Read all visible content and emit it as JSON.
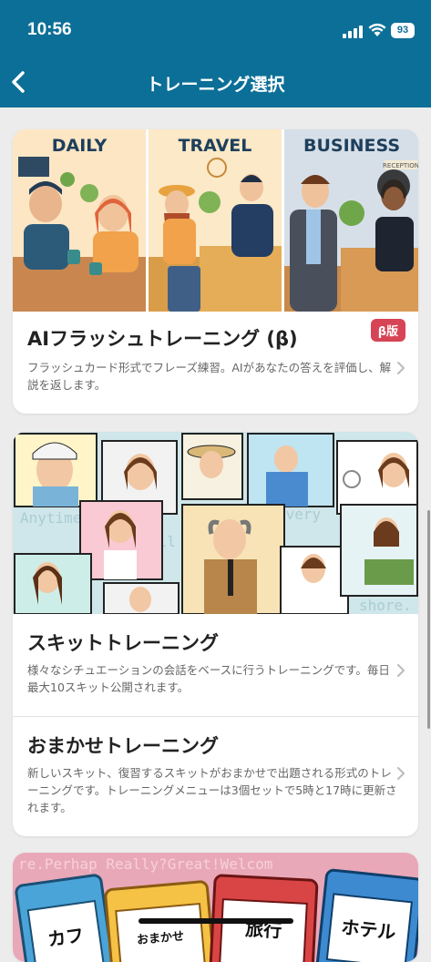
{
  "status": {
    "time": "10:56",
    "battery": "93"
  },
  "nav": {
    "title": "トレーニング選択"
  },
  "cards": {
    "flash": {
      "labels": [
        "DAILY",
        "TRAVEL",
        "BUSINESS"
      ],
      "sign": "RECEPTION",
      "title": "AIフラッシュトレーニング (β)",
      "badge": "β版",
      "desc": "フラッシュカード形式でフレーズ練習。AIがあなたの答えを評価し、解説を返します。"
    },
    "skit": {
      "bg_text": [
        "Anytime",
        "every",
        "all",
        "shore."
      ],
      "title": "スキットトレーニング",
      "desc": "様々なシチュエーションの会話をベースに行うトレーニングです。毎日最大10スキット公開されます。"
    },
    "omakase": {
      "title": "おまかせトレーニング",
      "desc": "新しいスキット、復習するスキットがおまかせで出題される形式のトレーニングです。トレーニングメニューは3個セットで5時と17時に更新されます。"
    },
    "cards": {
      "bg_text": "re.Perhap Really?Great!Welcom",
      "card_labels": [
        "カフ",
        "おまかせ",
        "旅行",
        "ホテル"
      ]
    }
  }
}
